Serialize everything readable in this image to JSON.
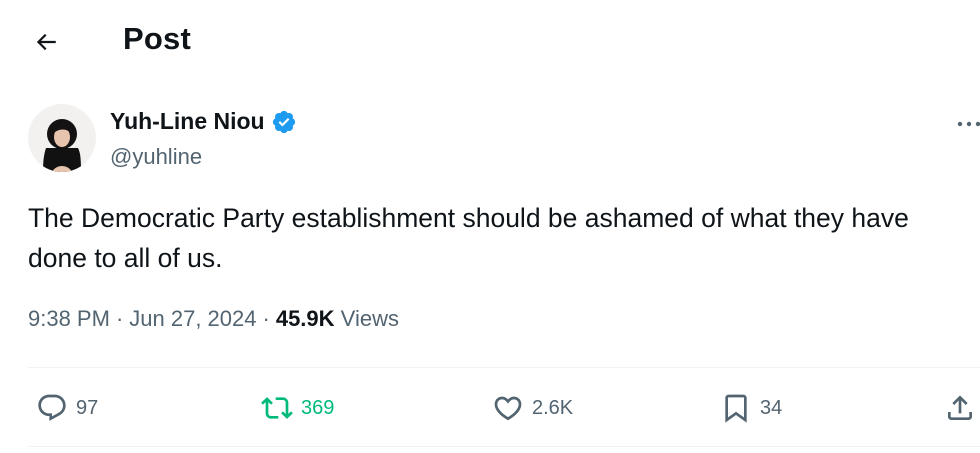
{
  "header": {
    "title": "Post",
    "back_icon": "arrow-left-icon"
  },
  "author": {
    "display_name": "Yuh-Line Niou",
    "handle": "@yuhline",
    "verified": true,
    "verified_color": "#1d9bf0"
  },
  "tweet": {
    "text": "The Democratic Party establishment should be ashamed of what they have done to all of us."
  },
  "meta": {
    "time": "9:38 PM",
    "separator": "·",
    "date": "Jun 27, 2024",
    "views_count": "45.9K",
    "views_label": "Views"
  },
  "actions": {
    "replies": "97",
    "reposts": "369",
    "likes": "2.6K",
    "bookmarks": "34"
  },
  "colors": {
    "text": "#0f1419",
    "secondary": "#536471",
    "repost_active": "#00ba7c",
    "divider": "#eff3f4"
  }
}
